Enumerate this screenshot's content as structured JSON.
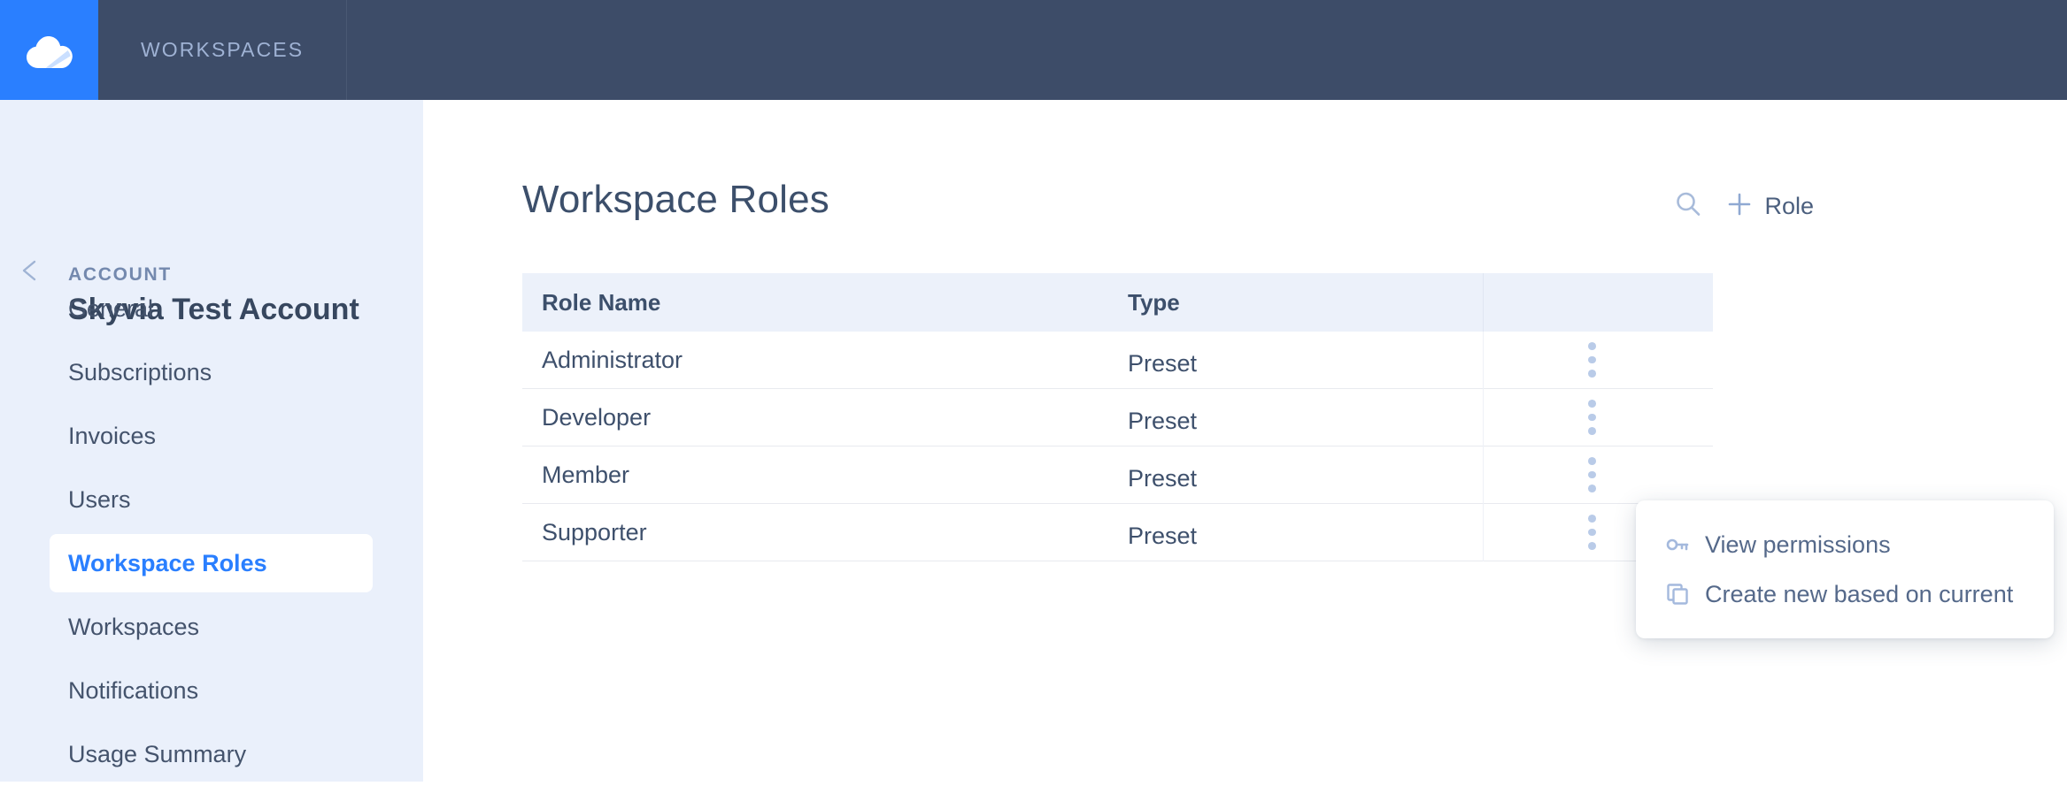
{
  "topbar": {
    "logo_icon": "cloud-logo-icon",
    "nav": [
      {
        "label": "WORKSPACES"
      }
    ]
  },
  "sidebar": {
    "back_icon": "chevron-left-icon",
    "section_label": "ACCOUNT",
    "account_name": "Skyvia Test Account",
    "items": [
      {
        "label": "General",
        "active": false
      },
      {
        "label": "Subscriptions",
        "active": false
      },
      {
        "label": "Invoices",
        "active": false
      },
      {
        "label": "Users",
        "active": false
      },
      {
        "label": "Workspace Roles",
        "active": true
      },
      {
        "label": "Workspaces",
        "active": false
      },
      {
        "label": "Notifications",
        "active": false
      },
      {
        "label": "Usage Summary",
        "active": false
      }
    ]
  },
  "main": {
    "title": "Workspace Roles",
    "toolbar": {
      "search_icon": "search-icon",
      "add_icon": "plus-icon",
      "add_label": "Role"
    },
    "table": {
      "columns": [
        "Role Name",
        "Type"
      ],
      "rows": [
        {
          "name": "Administrator",
          "type": "Preset"
        },
        {
          "name": "Developer",
          "type": "Preset"
        },
        {
          "name": "Member",
          "type": "Preset"
        },
        {
          "name": "Supporter",
          "type": "Preset"
        }
      ],
      "row_menu_icon": "kebab-menu-icon"
    },
    "context_menu": {
      "items": [
        {
          "icon": "key-icon",
          "label": "View permissions"
        },
        {
          "icon": "copy-icon",
          "label": "Create new based on current"
        }
      ]
    }
  },
  "colors": {
    "brand_blue": "#2a7fff",
    "header_navy": "#3d4c68",
    "sidebar_bg": "#eaf0fb",
    "text_slate": "#3e506c",
    "icon_light_blue": "#b9cbe8"
  }
}
